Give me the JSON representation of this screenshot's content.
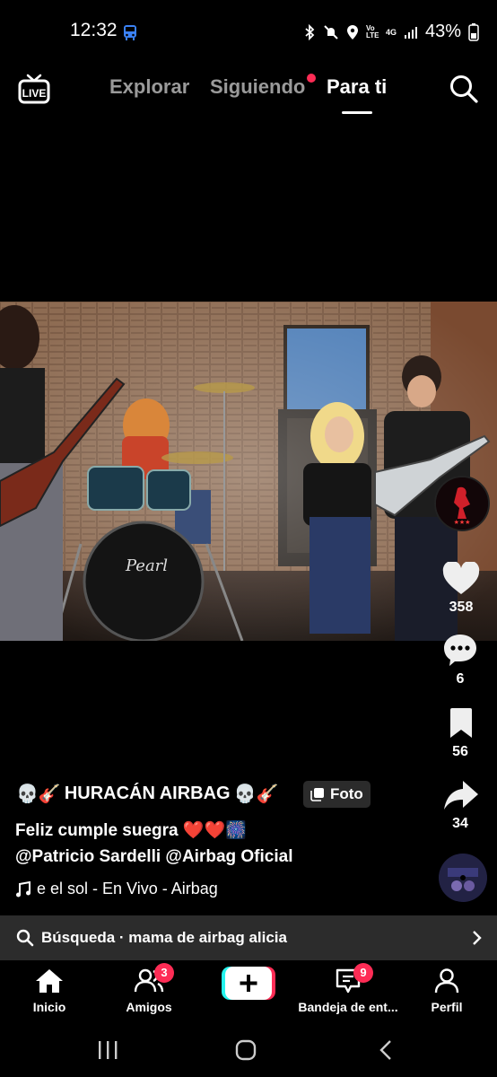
{
  "status_bar": {
    "time": "12:32",
    "battery": "43%",
    "network": "4G",
    "volte": "Vo LTE"
  },
  "top_nav": {
    "tabs": [
      {
        "label": "Explorar"
      },
      {
        "label": "Siguiendo"
      },
      {
        "label": "Para ti"
      }
    ],
    "active_tab": "Para ti",
    "live_label": "LIVE"
  },
  "photo": {
    "drum_brand": "Pearl"
  },
  "rail": {
    "likes": "358",
    "comments": "6",
    "bookmarks": "56",
    "shares": "34"
  },
  "caption": {
    "title": "HURACÁN AIRBAG",
    "title_emoji_prefix": "💀🎸",
    "title_emoji_suffix": "💀🎸",
    "badge": "Foto",
    "line1": "Feliz cumple suegra ❤️❤️🎆",
    "line2": "@Patricio Sardelli @Airbag Oficial",
    "music": "e el sol - En Vivo - Airbag"
  },
  "search_banner": {
    "text": "Búsqueda · mama de airbag alicia"
  },
  "bottom_nav": {
    "items": [
      {
        "label": "Inicio"
      },
      {
        "label": "Amigos",
        "badge": "3"
      },
      {
        "label": ""
      },
      {
        "label": "Bandeja de ent...",
        "badge": "9"
      },
      {
        "label": "Perfil"
      }
    ]
  },
  "colors": {
    "accent": "#fe2c55",
    "background": "#000000",
    "banner": "#2c2c2c",
    "inactive_tab": "#9a9a9a"
  }
}
